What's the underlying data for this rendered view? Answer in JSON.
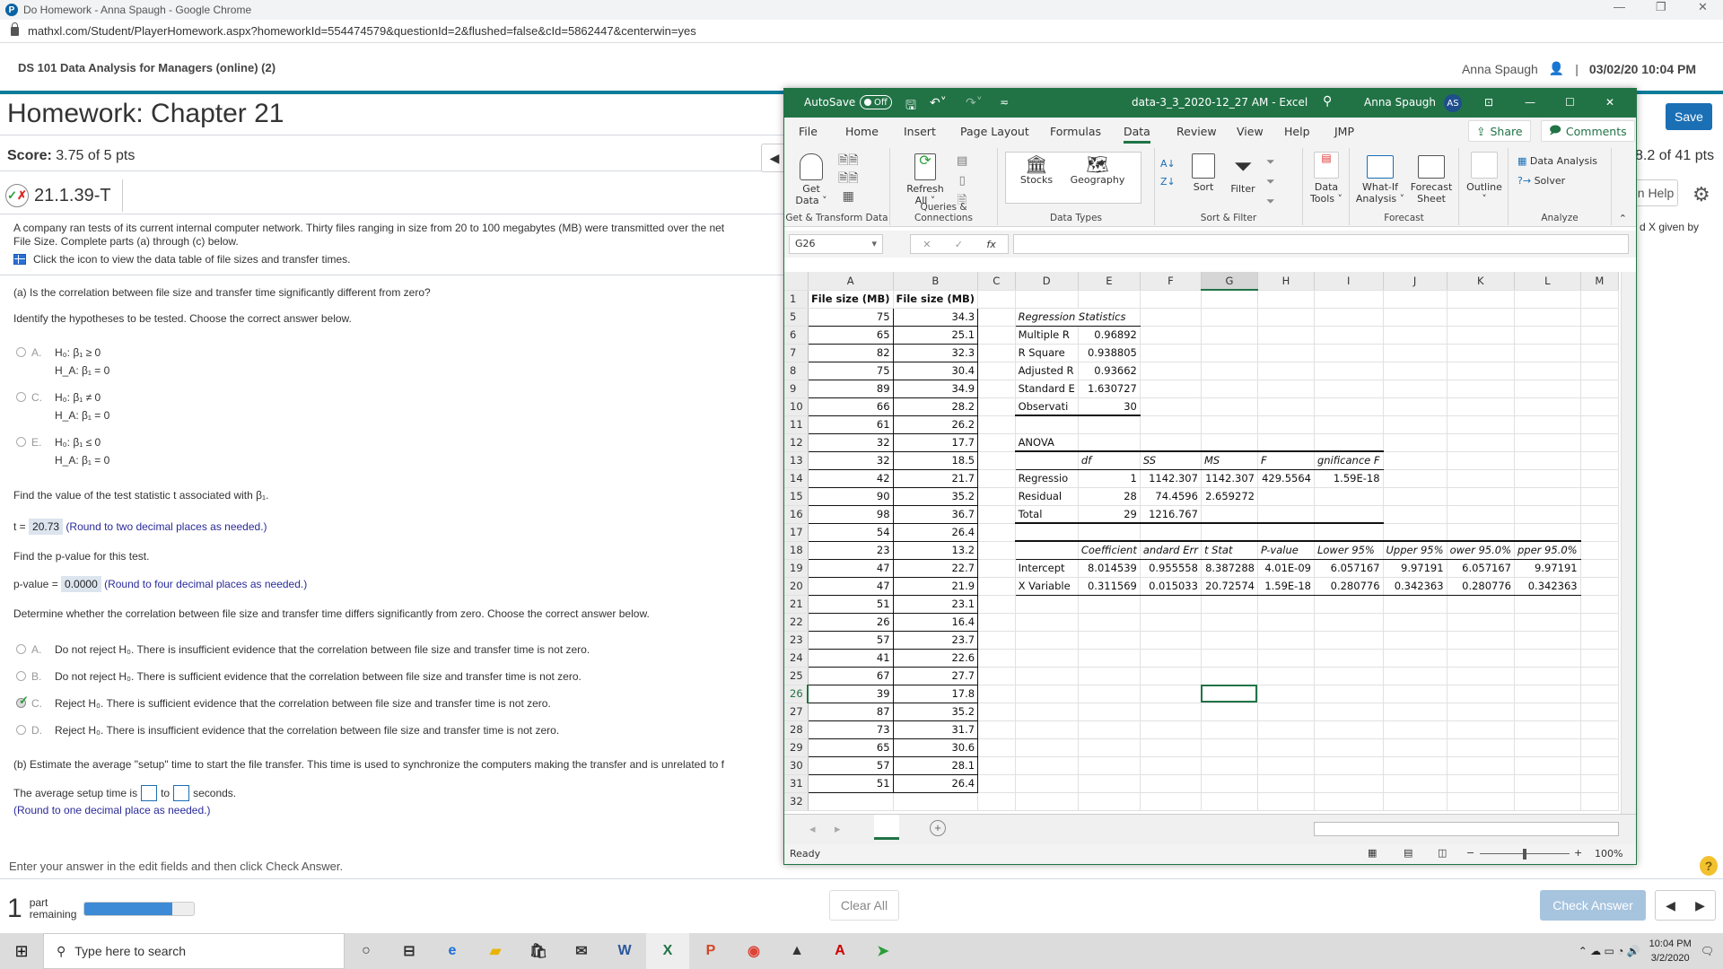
{
  "browser": {
    "window_title": "Do Homework - Anna Spaugh - Google Chrome",
    "url": "mathxl.com/Student/PlayerHomework.aspx?homeworkId=554474579&questionId=2&flushed=false&cId=5862447&centerwin=yes"
  },
  "header": {
    "course": "DS 101 Data Analysis for Managers (online) (2)",
    "user": "Anna Spaugh",
    "separator": "|",
    "datetime": "03/02/20 10:04 PM"
  },
  "homework": {
    "title": "Homework: Chapter 21",
    "score_label": "Score:",
    "score_value": "3.75 of 5 pts",
    "question_id": "21.1.39-T",
    "hw_points": "8.2 of 41 pts",
    "save_label": "Save",
    "help_label": "n Help",
    "cutoff_text": "d X given by"
  },
  "question": {
    "intro_line1": "A company ran tests of its current internal computer network. Thirty files ranging in size from 20 to 100 megabytes (MB) were transmitted over the net",
    "intro_line2": "File Size. Complete parts (a) through (c) below.",
    "data_link": "Click the icon to view the data table of file sizes and transfer times.",
    "part_a": "(a) Is the correlation between file size and transfer time significantly different from zero?",
    "identify": "Identify the hypotheses to be tested. Choose the correct answer below.",
    "hypotheses": [
      {
        "letter": "A.",
        "h0": "H₀: β₁ ≥ 0",
        "ha": "H_A: β₁ = 0"
      },
      {
        "letter": "C.",
        "h0": "H₀: β₁ ≠ 0",
        "ha": "H_A: β₁ = 0"
      },
      {
        "letter": "E.",
        "h0": "H₀: β₁ ≤ 0",
        "ha": "H_A: β₁ = 0"
      }
    ],
    "find_t": "Find the value of the test statistic t associated with β₁.",
    "t_label": "t =",
    "t_value": "20.73",
    "t_hint": "(Round to two decimal places as needed.)",
    "find_p": "Find the p-value for this test.",
    "p_label": "p-value =",
    "p_value": "0.0000",
    "p_hint": "(Round to four decimal places as needed.)",
    "determine": "Determine whether the correlation between file size and transfer time differs significantly from zero. Choose the correct answer below.",
    "conclusions": [
      {
        "letter": "A.",
        "text": "Do not reject H₀. There is insufficient evidence that the correlation between file size and transfer time is not zero.",
        "selected": false
      },
      {
        "letter": "B.",
        "text": "Do not reject H₀. There is sufficient evidence that the correlation between file size and transfer time is not zero.",
        "selected": false
      },
      {
        "letter": "C.",
        "text": "Reject H₀. There is sufficient evidence that the correlation between file size and transfer time is not zero.",
        "selected": true
      },
      {
        "letter": "D.",
        "text": "Reject H₀. There is insufficient evidence that the correlation between file size and transfer time is not zero.",
        "selected": false
      }
    ],
    "part_b": "(b) Estimate the average \"setup\" time to start the file transfer. This time is used to synchronize the computers making the transfer and is unrelated to f",
    "setup_prefix": "The average setup time is",
    "setup_to": "to",
    "setup_suffix": "seconds.",
    "setup_hint": "(Round to one decimal place as needed.)",
    "setup_low": "",
    "setup_high": "",
    "instruction": "Enter your answer in the edit fields and then click Check Answer."
  },
  "footer": {
    "parts_num": "1",
    "parts_label1": "part",
    "parts_label2": "remaining",
    "progress_fraction": 0.8,
    "clear_label": "Clear All",
    "check_label": "Check Answer",
    "help_icon": "?"
  },
  "excel": {
    "autosave": "AutoSave",
    "autosave_state": "Off",
    "filename": "data-3_3_2020-12_27 AM  -  Excel",
    "user": "Anna Spaugh",
    "user_initials": "AS",
    "tabs": [
      "File",
      "Home",
      "Insert",
      "Page Layout",
      "Formulas",
      "Data",
      "Review",
      "View",
      "Help",
      "JMP"
    ],
    "active_tab": "Data",
    "share": "Share",
    "comments": "Comments",
    "ribbon_groups": [
      {
        "label": "Get & Transform Data",
        "buttons": [
          "Get Data ˅"
        ]
      },
      {
        "label": "Queries & Connections",
        "buttons": [
          "Refresh All ˅"
        ]
      },
      {
        "label": "Data Types",
        "buttons": [
          "Stocks",
          "Geography"
        ]
      },
      {
        "label": "Sort & Filter",
        "buttons": [
          "Sort",
          "Filter"
        ]
      },
      {
        "label": "",
        "buttons": [
          "Data Tools ˅"
        ]
      },
      {
        "label": "Forecast",
        "buttons": [
          "What-If Analysis ˅",
          "Forecast Sheet"
        ]
      },
      {
        "label": "",
        "buttons": [
          "Outline"
        ]
      },
      {
        "label": "Analyze",
        "buttons": [
          "Data Analysis",
          "Solver"
        ]
      }
    ],
    "name_box": "G26",
    "formula": "",
    "columns": [
      "A",
      "B",
      "C",
      "D",
      "E",
      "F",
      "G",
      "H",
      "I",
      "J",
      "K",
      "L",
      "M"
    ],
    "header_row": {
      "row": "1",
      "A": "File size (MB)",
      "B": "File size (MB)"
    },
    "data_rows": [
      {
        "row": "5",
        "A": "75",
        "B": "34.3"
      },
      {
        "row": "6",
        "A": "65",
        "B": "25.1"
      },
      {
        "row": "7",
        "A": "82",
        "B": "32.3"
      },
      {
        "row": "8",
        "A": "75",
        "B": "30.4"
      },
      {
        "row": "9",
        "A": "89",
        "B": "34.9"
      },
      {
        "row": "10",
        "A": "66",
        "B": "28.2"
      },
      {
        "row": "11",
        "A": "61",
        "B": "26.2"
      },
      {
        "row": "12",
        "A": "32",
        "B": "17.7"
      },
      {
        "row": "13",
        "A": "32",
        "B": "18.5"
      },
      {
        "row": "14",
        "A": "42",
        "B": "21.7"
      },
      {
        "row": "15",
        "A": "90",
        "B": "35.2"
      },
      {
        "row": "16",
        "A": "98",
        "B": "36.7"
      },
      {
        "row": "17",
        "A": "54",
        "B": "26.4"
      },
      {
        "row": "18",
        "A": "23",
        "B": "13.2"
      },
      {
        "row": "19",
        "A": "47",
        "B": "22.7"
      },
      {
        "row": "20",
        "A": "47",
        "B": "21.9"
      },
      {
        "row": "21",
        "A": "51",
        "B": "23.1"
      },
      {
        "row": "22",
        "A": "26",
        "B": "16.4"
      },
      {
        "row": "23",
        "A": "57",
        "B": "23.7"
      },
      {
        "row": "24",
        "A": "41",
        "B": "22.6"
      },
      {
        "row": "25",
        "A": "67",
        "B": "27.7"
      },
      {
        "row": "26",
        "A": "39",
        "B": "17.8"
      },
      {
        "row": "27",
        "A": "87",
        "B": "35.2"
      },
      {
        "row": "28",
        "A": "73",
        "B": "31.7"
      },
      {
        "row": "29",
        "A": "65",
        "B": "30.6"
      },
      {
        "row": "30",
        "A": "57",
        "B": "28.1"
      },
      {
        "row": "31",
        "A": "51",
        "B": "26.4"
      },
      {
        "row": "32",
        "A": "",
        "B": ""
      }
    ],
    "regression_stats": {
      "title": "Regression Statistics",
      "rows": [
        {
          "label": "Multiple R",
          "value": "0.96892"
        },
        {
          "label": "R Square",
          "value": "0.938805"
        },
        {
          "label": "Adjusted R",
          "value": "0.93662"
        },
        {
          "label": "Standard E",
          "value": "1.630727"
        },
        {
          "label": "Observati",
          "value": "30"
        }
      ]
    },
    "anova": {
      "title": "ANOVA",
      "headers": [
        "",
        "df",
        "SS",
        "MS",
        "F",
        "gnificance F"
      ],
      "rows": [
        [
          "Regressio",
          "1",
          "1142.307",
          "1142.307",
          "429.5564",
          "1.59E-18"
        ],
        [
          "Residual",
          "28",
          "74.4596",
          "2.659272",
          "",
          ""
        ],
        [
          "Total",
          "29",
          "1216.767",
          "",
          "",
          ""
        ]
      ]
    },
    "coefficients": {
      "headers": [
        "",
        "Coefficient",
        "andard Err",
        "t Stat",
        "P-value",
        "Lower 95%",
        "Upper 95%",
        "ower 95.0%",
        "pper 95.0%"
      ],
      "rows": [
        [
          "Intercept",
          "8.014539",
          "0.955558",
          "8.387288",
          "4.01E-09",
          "6.057167",
          "9.97191",
          "6.057167",
          "9.97191"
        ],
        [
          "X Variable",
          "0.311569",
          "0.015033",
          "20.72574",
          "1.59E-18",
          "0.280776",
          "0.342363",
          "0.280776",
          "0.342363"
        ]
      ]
    },
    "status": "Ready",
    "zoom": "100%"
  },
  "taskbar": {
    "search_placeholder": "Type here to search",
    "time": "10:04 PM",
    "date": "3/2/2020"
  }
}
